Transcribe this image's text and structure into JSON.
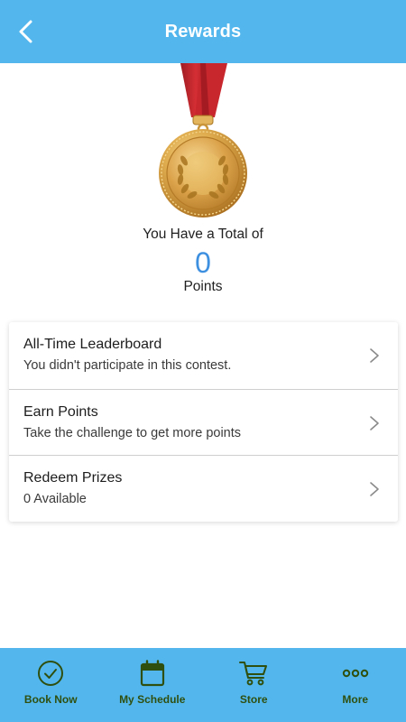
{
  "header": {
    "title": "Rewards",
    "back_icon": "chevron-left-icon"
  },
  "summary": {
    "total_label": "You Have a Total of",
    "points_value": "0",
    "points_label": "Points",
    "medal_icon": "gold-medal-icon"
  },
  "menu": {
    "items": [
      {
        "title": "All-Time Leaderboard",
        "subtitle": "You didn't participate in this contest.",
        "icon": "chevron-right-icon"
      },
      {
        "title": "Earn Points",
        "subtitle": "Take the challenge to get more points",
        "icon": "chevron-right-icon"
      },
      {
        "title": "Redeem Prizes",
        "subtitle": "0 Available",
        "icon": "chevron-right-icon"
      }
    ]
  },
  "tabbar": {
    "items": [
      {
        "label": "Book Now",
        "icon": "check-circle-icon"
      },
      {
        "label": "My Schedule",
        "icon": "calendar-icon"
      },
      {
        "label": "Store",
        "icon": "cart-icon"
      },
      {
        "label": "More",
        "icon": "more-dots-icon"
      }
    ]
  },
  "colors": {
    "primary": "#53b7ee",
    "points": "#3d8fe0",
    "tab_icon": "#2f4f0f",
    "medal_gold": "#d9a441",
    "ribbon": "#c1272d"
  }
}
